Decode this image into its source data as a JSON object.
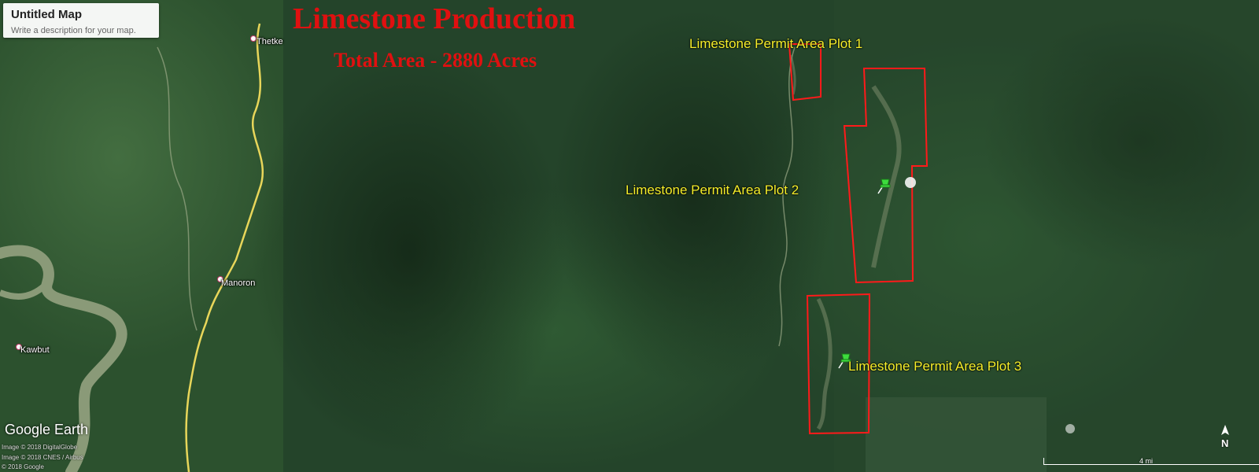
{
  "map_card": {
    "title": "Untitled Map",
    "description": "Write a description for your map."
  },
  "heading": {
    "title": "Limestone Production",
    "subtitle": "Total Area - 2880 Acres"
  },
  "plots": [
    {
      "label": "Limestone Permit Area Plot 2"
    },
    {
      "label": "Limestone Permit Area Plot 1"
    },
    {
      "label": "Limestone Permit Area Plot 3"
    }
  ],
  "places": [
    {
      "name": "Thetke"
    },
    {
      "name": "Manoron"
    },
    {
      "name": "Kawbut"
    }
  ],
  "branding": {
    "logo": "Google Earth",
    "credits": [
      "Image © 2018 DigitalGlobe",
      "Image © 2018 CNES / Airbus",
      "© 2018 Google"
    ]
  },
  "scale_bar": {
    "label": "4 mi"
  },
  "compass": {
    "label": "N"
  },
  "colors": {
    "title_red": "#e01010",
    "label_yellow": "#f5ee2a",
    "plot_outline": "#ff1a1a",
    "road_yellow": "#e8d65a",
    "river": "#8a9a78",
    "pin_green": "#3ddc3d"
  },
  "icons": {
    "pin": "pushpin-icon",
    "compass": "north-arrow-icon"
  }
}
